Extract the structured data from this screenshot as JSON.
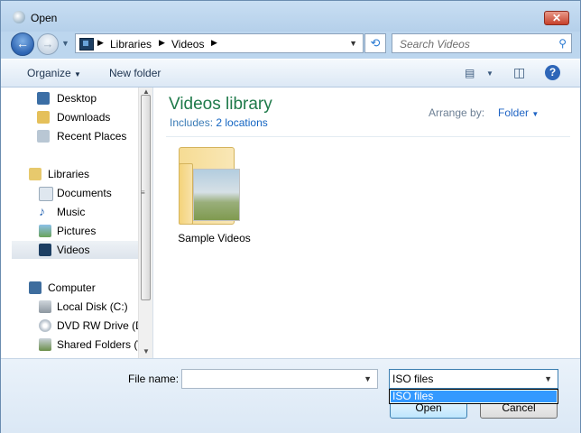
{
  "window": {
    "title": "Open",
    "close_glyph": "✕"
  },
  "nav": {
    "back_glyph": "←",
    "forward_glyph": "→",
    "history_glyph": "▼",
    "breadcrumb": [
      "Libraries",
      "Videos"
    ],
    "breadcrumb_sep": "▶",
    "address_dropdown_glyph": "▼",
    "refresh_glyph": "⟲",
    "search_placeholder": "Search Videos",
    "search_glyph": "⚲"
  },
  "toolbar": {
    "organize_label": "Organize",
    "organize_arrow": "▼",
    "new_folder_label": "New folder",
    "view_glyph": "▤",
    "view_arrow": "▼",
    "preview_glyph": "◫",
    "help_glyph": "?"
  },
  "sidebar": {
    "favorites": [
      {
        "label": "Desktop",
        "icon": "desktop-icon"
      },
      {
        "label": "Downloads",
        "icon": "downloads-icon"
      },
      {
        "label": "Recent Places",
        "icon": "recent-places-icon"
      }
    ],
    "libraries_label": "Libraries",
    "libraries": [
      {
        "label": "Documents",
        "icon": "documents-icon"
      },
      {
        "label": "Music",
        "icon": "music-icon"
      },
      {
        "label": "Pictures",
        "icon": "pictures-icon"
      },
      {
        "label": "Videos",
        "icon": "videos-icon",
        "selected": true
      }
    ],
    "computer_label": "Computer",
    "computer": [
      {
        "label": "Local Disk (C:)",
        "icon": "local-disk-icon"
      },
      {
        "label": "DVD RW Drive (D",
        "icon": "dvd-drive-icon"
      },
      {
        "label": "Shared Folders (\\",
        "icon": "shared-folders-icon"
      }
    ],
    "scroll_up_glyph": "▲",
    "scroll_down_glyph": "▼",
    "grip_glyph": "≡"
  },
  "content": {
    "library_title": "Videos library",
    "includes_label": "Includes:",
    "includes_value": "2 locations",
    "arrange_label": "Arrange by:",
    "arrange_value": "Folder",
    "arrange_arrow": "▼",
    "items": [
      {
        "label": "Sample Videos"
      }
    ]
  },
  "footer": {
    "file_name_label": "File name:",
    "file_name_value": "",
    "file_name_dropdown": "▼",
    "file_type_selected": "ISO files",
    "file_type_dropdown": "▼",
    "file_type_options": [
      "ISO files"
    ],
    "open_label": "Open",
    "cancel_label": "Cancel"
  }
}
